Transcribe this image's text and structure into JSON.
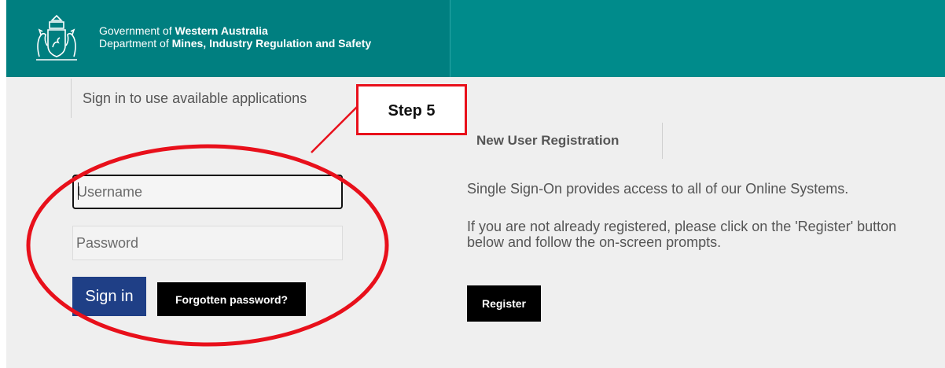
{
  "header": {
    "line1_prefix": "Government of ",
    "line1_bold": "Western Australia",
    "line2_prefix": "Department of ",
    "line2_bold": "Mines, Industry Regulation and Safety"
  },
  "sign_in": {
    "tab_label": "Sign in to use available applications",
    "username_placeholder": "Username",
    "password_placeholder": "Password",
    "sign_in_label": "Sign in",
    "forgotten_label": "Forgotten password?"
  },
  "registration": {
    "tab_label": "New User Registration",
    "info_line1": "Single Sign-On provides access to all of our Online Systems.",
    "info_line2": "If you are not already registered, please click on the 'Register' button below and follow the on-screen prompts.",
    "register_label": "Register"
  },
  "annotation": {
    "step_label": "Step 5",
    "color": "#e8101b"
  },
  "colors": {
    "header_teal": "#008b8b",
    "sign_in_blue": "#1f3f86"
  }
}
